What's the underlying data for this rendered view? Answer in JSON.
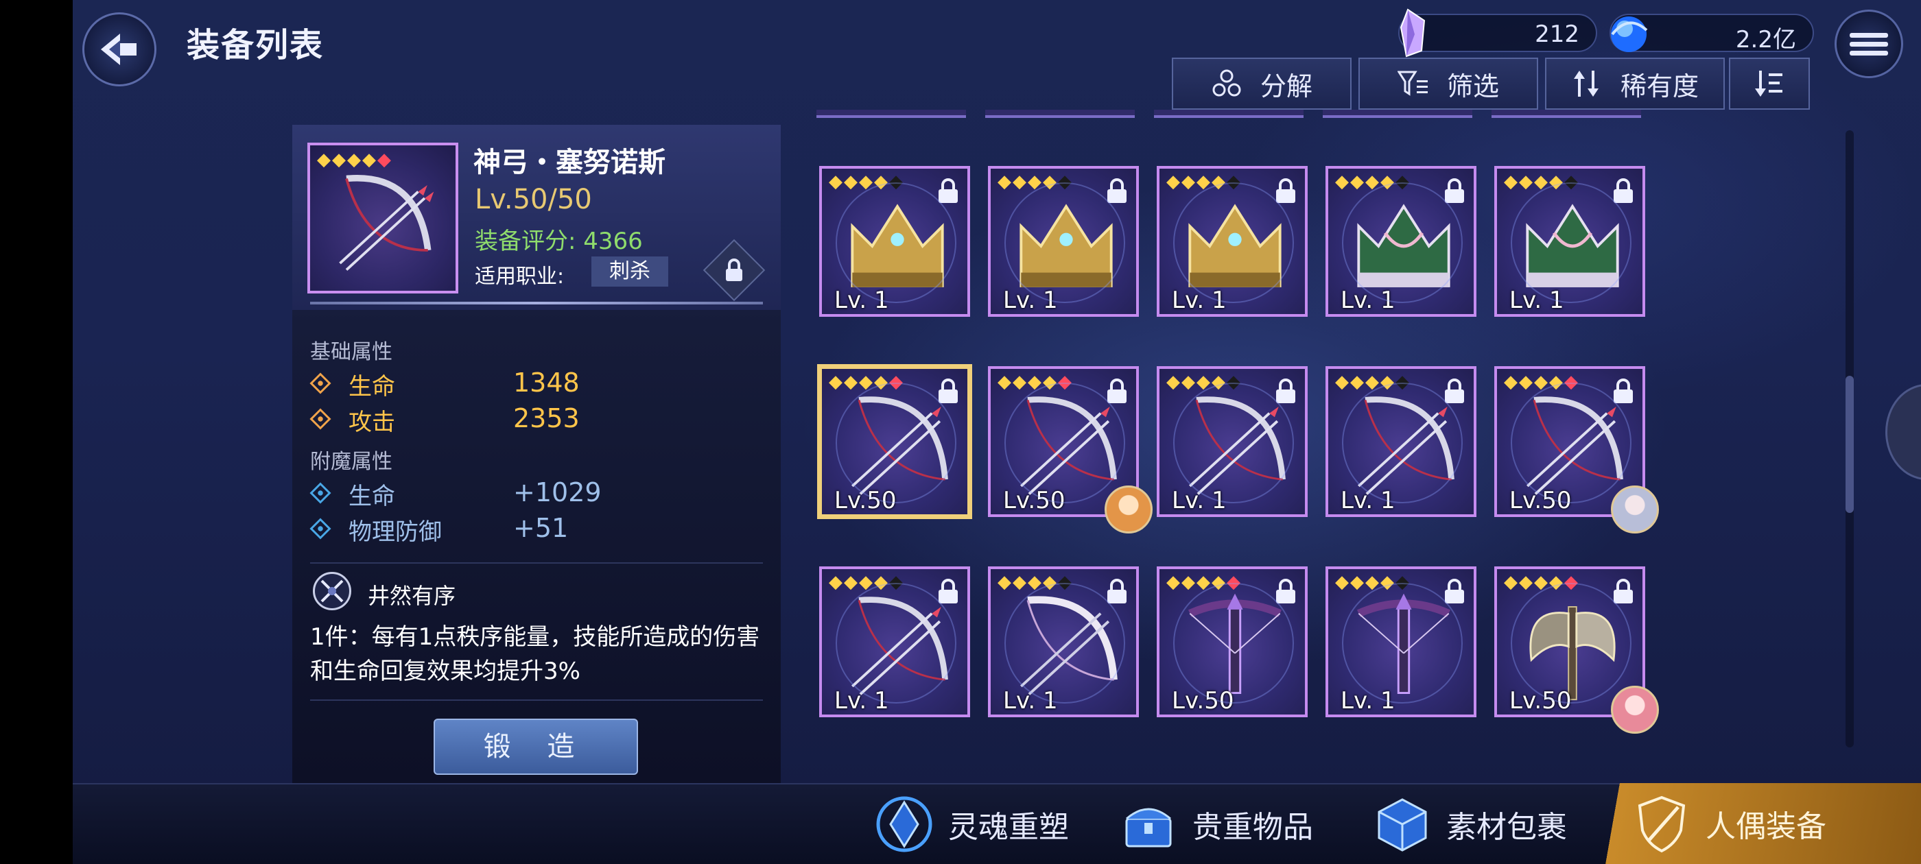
{
  "header": {
    "title": "装备列表"
  },
  "resources": [
    {
      "icon": "crystal-icon",
      "value": "212"
    },
    {
      "icon": "blue-orb-icon",
      "value": "2.2亿"
    }
  ],
  "toolbar": {
    "decompose": "分解",
    "filter": "筛选",
    "rarity": "稀有度",
    "sort_icon": "sort-order-icon"
  },
  "detail": {
    "name": "神弓・塞努诺斯",
    "level": "Lv.50/50",
    "score": "装备评分: 4366",
    "job_label": "适用职业:",
    "job": "刺杀",
    "base_title": "基础属性",
    "base_attrs": [
      {
        "name": "生命",
        "value": "1348"
      },
      {
        "name": "攻击",
        "value": "2353"
      }
    ],
    "ench_title": "附魔属性",
    "ench_attrs": [
      {
        "name": "生命",
        "value": "+1029"
      },
      {
        "name": "物理防御",
        "value": "+51"
      }
    ],
    "set_name": "井然有序",
    "set_desc": "1件：每有1点秩序能量，技能所造成的伤害和生命回复效果均提升3%",
    "forge": "锻 造"
  },
  "grid": {
    "rows": [
      [
        {
          "type": "crown-gold",
          "stars": [
            "y",
            "y",
            "y",
            "y",
            "k"
          ],
          "level": "Lv. 1"
        },
        {
          "type": "crown-gold",
          "stars": [
            "y",
            "y",
            "y",
            "y",
            "k"
          ],
          "level": "Lv. 1"
        },
        {
          "type": "crown-gold",
          "stars": [
            "y",
            "y",
            "y",
            "y",
            "k"
          ],
          "level": "Lv. 1"
        },
        {
          "type": "crown-green",
          "stars": [
            "y",
            "y",
            "y",
            "y",
            "k"
          ],
          "level": "Lv. 1"
        },
        {
          "type": "crown-green",
          "stars": [
            "y",
            "y",
            "y",
            "y",
            "k"
          ],
          "level": "Lv. 1"
        }
      ],
      [
        {
          "type": "bow-red",
          "stars": [
            "y",
            "y",
            "y",
            "y",
            "r"
          ],
          "level": "Lv.50",
          "selected": true
        },
        {
          "type": "bow-red",
          "stars": [
            "y",
            "y",
            "y",
            "y",
            "r"
          ],
          "level": "Lv.50",
          "avatar": "orange"
        },
        {
          "type": "bow-red",
          "stars": [
            "y",
            "y",
            "y",
            "y",
            "k"
          ],
          "level": "Lv. 1"
        },
        {
          "type": "bow-red",
          "stars": [
            "y",
            "y",
            "y",
            "y",
            "k"
          ],
          "level": "Lv. 1"
        },
        {
          "type": "bow-red",
          "stars": [
            "y",
            "y",
            "y",
            "y",
            "r"
          ],
          "level": "Lv.50",
          "avatar": "silver"
        }
      ],
      [
        {
          "type": "bow-red",
          "stars": [
            "y",
            "y",
            "y",
            "y",
            "k"
          ],
          "level": "Lv. 1"
        },
        {
          "type": "bow-white",
          "stars": [
            "y",
            "y",
            "y",
            "y",
            "k"
          ],
          "level": "Lv. 1"
        },
        {
          "type": "crossbow",
          "stars": [
            "y",
            "y",
            "y",
            "y",
            "r"
          ],
          "level": "Lv.50"
        },
        {
          "type": "crossbow",
          "stars": [
            "y",
            "y",
            "y",
            "y",
            "k"
          ],
          "level": "Lv. 1"
        },
        {
          "type": "axe",
          "stars": [
            "y",
            "y",
            "y",
            "y",
            "r"
          ],
          "level": "Lv.50",
          "avatar": "pink"
        }
      ]
    ]
  },
  "bottom_nav": [
    {
      "icon": "soul-reshape-icon",
      "label": "灵魂重塑"
    },
    {
      "icon": "treasure-chest-icon",
      "label": "贵重物品"
    },
    {
      "icon": "material-package-icon",
      "label": "素材包裹"
    },
    {
      "icon": "doll-equipment-icon",
      "label": "人偶装备"
    }
  ],
  "colors": {
    "accent_gold": "#c98b2a",
    "star_yellow": "#ffd24a",
    "star_red": "#ff4b5e",
    "score_green": "#8fdc6c"
  }
}
